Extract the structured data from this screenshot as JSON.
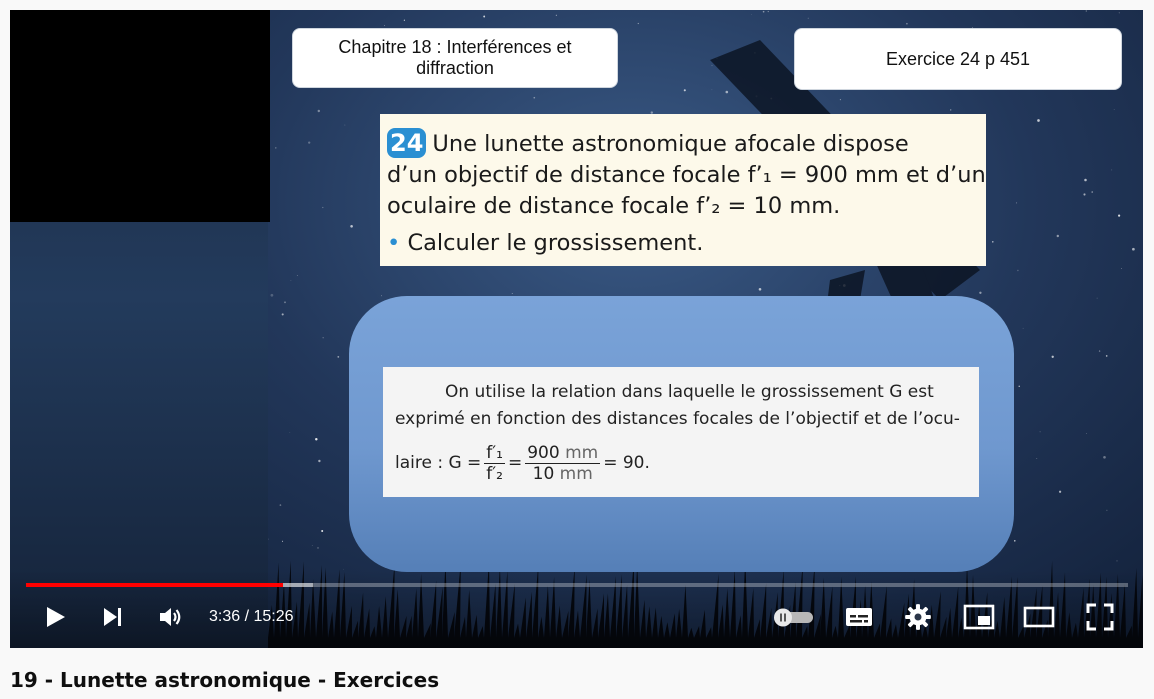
{
  "slide": {
    "chapter": "Chapitre 18 : Interférences et diffraction",
    "exercise": "Exercice 24 p 451",
    "problem": {
      "number": "24",
      "line1": "Une lunette astronomique afocale dispose",
      "line2": "d’un objectif de distance focale f’₁ = 900 mm et d’un",
      "line3": "oculaire de distance focale f’₂ = 10 mm.",
      "bullet": "•",
      "question": "Calculer le grossissement."
    },
    "answer": {
      "line1": "On utilise la relation dans laquelle le grossissement G est",
      "line2": "exprimé en fonction des distances focales de l’objectif et de l’ocu-",
      "line3_prefix": "laire : G =",
      "frac1_num": "f′₁",
      "frac1_den": "f′₂",
      "eq": "=",
      "frac2_num_value": "900",
      "frac2_num_unit": "mm",
      "frac2_den_value": "10",
      "frac2_den_unit": "mm",
      "result": "= 90."
    }
  },
  "player": {
    "current_time": "3:36",
    "duration": "15:26",
    "time_display": "3:36 / 15:26",
    "progress_fraction": 0.233,
    "buffer_fraction": 0.26,
    "progress_color": "#ff0000",
    "icons": [
      "play-icon",
      "next-icon",
      "volume-icon",
      "autoplay-toggle-icon",
      "subtitles-icon",
      "settings-icon",
      "miniplayer-icon",
      "theater-mode-icon",
      "fullscreen-icon"
    ]
  },
  "video": {
    "title": "19 - Lunette astronomique - Exercices"
  }
}
